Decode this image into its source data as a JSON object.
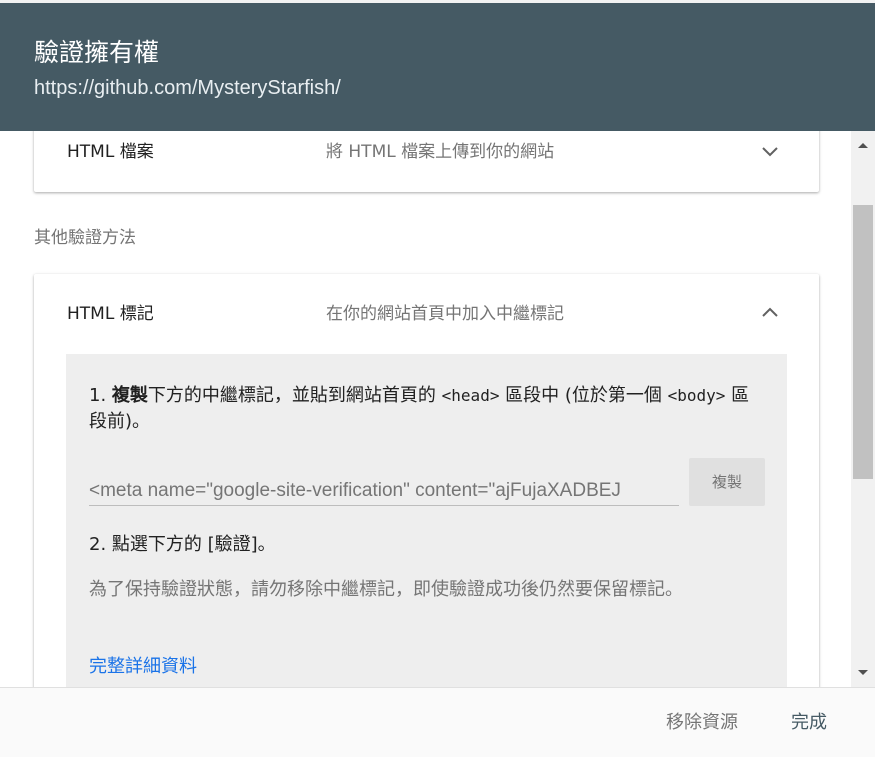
{
  "dialog": {
    "title": "驗證擁有權",
    "property_url": "https://github.com/MysteryStarfish/"
  },
  "methods": {
    "html_file": {
      "name": "HTML 檔案",
      "description": "將 HTML 檔案上傳到你的網站",
      "icon": "chevron-down-icon"
    },
    "other_label": "其他驗證方法",
    "html_tag": {
      "name": "HTML 標記",
      "description": "在你的網站首頁中加入中繼標記",
      "icon": "chevron-up-icon",
      "step1": {
        "number": "1.",
        "bold": "複製",
        "text_a": "下方的中繼標記，並貼到網站首頁的 ",
        "code_head": "<head>",
        "text_b": " 區段中 (位於第一個 ",
        "code_body": "<body>",
        "text_c": " 區段前)。"
      },
      "meta_tag_value": "<meta name=\"google-site-verification\" content=\"ajFujaXADBEJ",
      "copy_label": "複製",
      "step2": "2. 點選下方的 [驗證]。",
      "note": "為了保持驗證狀態，請勿移除中繼標記，即使驗證成功後仍然要保留標記。",
      "details_link": "完整詳細資料"
    }
  },
  "footer": {
    "remove_label": "移除資源",
    "done_label": "完成"
  },
  "colors": {
    "header_bg": "#455a64",
    "link": "#1a73e8",
    "panel_bg": "#eeeeee"
  }
}
